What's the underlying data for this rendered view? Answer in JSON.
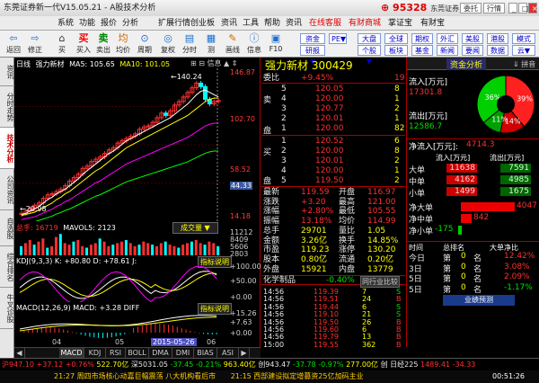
{
  "window": {
    "title": "东莞证券新一代V15.05.21 - A股技术分析",
    "version_tag": "50",
    "brand": "95328",
    "brand_sub": "东莞证券",
    "buttons": [
      "委托",
      "行情"
    ]
  },
  "menu": [
    "系统",
    "功能",
    "报价",
    "分析",
    "扩展行情",
    "创业板",
    "资讯",
    "工具",
    "帮助",
    "资讯",
    "在线客服",
    "有财商城",
    "掌证宝",
    "有财宝"
  ],
  "toolbar": {
    "tools": [
      "返回",
      "修正",
      "买",
      "卖",
      "均",
      "周期",
      "复权",
      "分时",
      "测",
      "画线",
      "信息",
      "F10"
    ],
    "right_buttons": [
      "资金▼",
      "研报▼",
      "PE▼",
      "大盘▼",
      "全球▼",
      "期权",
      "外汇",
      "美股",
      "港股",
      "个股▼",
      "板块",
      "基金▼",
      "新闻",
      "要闻",
      "数据▼",
      "个股▼",
      "模式",
      "云▼"
    ]
  },
  "left_tabs": [
    "资讯",
    "分时走势",
    "技术分析",
    "公司资讯",
    "自选股",
    "综合排名",
    "牛叉诊股"
  ],
  "chart": {
    "header": {
      "period": "日线",
      "name": "强力新材",
      "ma5": "MA5: 105.65",
      "ma10": "MA10: 101.05",
      "ma20": "MA20: 89.43",
      "ma60": "MA60: 66.02"
    },
    "price_max": "146.87",
    "price_2": "102.70",
    "price_3": "58.52",
    "price_4": "44.33",
    "price_min": "14.18",
    "high_label": "140.24",
    "low_label": "20.98",
    "vol_header": {
      "title": "总手: 16719",
      "mavol": "MAVOL5: 2123"
    },
    "vol_button": "成交量",
    "vol_labels": [
      "11212",
      "8409",
      "5606",
      "2803"
    ],
    "kdj_header": "KDJ(9,3,3) K: +80.80 D: +78.61 J:",
    "kdj_button": "指标说明",
    "kdj_labels": [
      "+100.00",
      "+50.00",
      "+0.00"
    ],
    "macd_header": "MACD(12,26,9) MACD: +3.28 DIFF",
    "macd_button": "指标说明",
    "macd_labels": [
      "+15.26",
      "+7.63",
      "+0.00"
    ],
    "dates": [
      "04",
      "05",
      "2015-05-26",
      "06"
    ],
    "price_levels": {
      "max": 146.87,
      "min": 14.18
    },
    "series": {
      "close": [
        21,
        23,
        25,
        28,
        30,
        34,
        37,
        38,
        40,
        42,
        45,
        49,
        52,
        55,
        60,
        62,
        66,
        68,
        70,
        73,
        76,
        78,
        82,
        84,
        86,
        88,
        90,
        94,
        96,
        97,
        100,
        104,
        108,
        106,
        110,
        115,
        118,
        122,
        126,
        130,
        134,
        131,
        120,
        116,
        118,
        119
      ],
      "ma5": [
        20,
        21,
        23,
        25,
        27,
        30,
        33,
        35,
        38,
        40,
        42,
        45,
        48,
        51,
        55,
        58,
        61,
        64,
        67,
        70,
        73,
        75,
        78,
        81,
        84,
        86,
        88,
        90,
        92,
        94,
        96,
        98,
        100,
        102,
        104,
        107,
        110,
        113,
        116,
        120,
        124,
        127,
        128,
        126,
        124,
        122
      ],
      "ma10": [
        19,
        20,
        21,
        22,
        24,
        26,
        28,
        30,
        33,
        35,
        38,
        40,
        43,
        46,
        49,
        52,
        55,
        58,
        60,
        63,
        66,
        69,
        72,
        75,
        78,
        80,
        82,
        84,
        86,
        88,
        90,
        92,
        94,
        96,
        98,
        100,
        102,
        104,
        106,
        109,
        112,
        115,
        118,
        120,
        121,
        121
      ]
    },
    "volume": [
      6,
      8,
      10,
      7,
      9,
      11,
      5,
      6,
      12,
      14,
      8,
      7,
      9,
      10,
      6,
      5,
      7,
      8,
      11,
      9,
      6,
      7,
      8,
      9,
      10,
      8,
      6,
      7,
      9,
      8,
      7,
      6,
      8,
      9,
      7,
      6,
      5,
      7,
      8,
      9,
      10,
      8,
      7,
      9,
      8,
      6
    ]
  },
  "bottom_tabs": [
    "MACD",
    "KDJ",
    "RSI",
    "BOLL",
    "DMA",
    "DMI",
    "BIAS",
    "ASI"
  ],
  "quote": {
    "title": "强力新材 300429",
    "webi": "+9.45%",
    "webi_label": "委比",
    "webi_right": "19",
    "sell": [
      {
        "lvl": "5",
        "p": "120.05",
        "v": "8"
      },
      {
        "lvl": "4",
        "p": "120.00",
        "v": "1"
      },
      {
        "lvl": "3",
        "p": "120.77",
        "v": "2"
      },
      {
        "lvl": "2",
        "p": "120.01",
        "v": "1"
      },
      {
        "lvl": "1",
        "p": "120.00",
        "v": "82"
      }
    ],
    "buy": [
      {
        "lvl": "1",
        "p": "120.52",
        "v": "6"
      },
      {
        "lvl": "2",
        "p": "120.00",
        "v": "8"
      },
      {
        "lvl": "3",
        "p": "120.01",
        "v": "2"
      },
      {
        "lvl": "4",
        "p": "120.00",
        "v": "1"
      },
      {
        "lvl": "5",
        "p": "119.50",
        "v": "2"
      }
    ],
    "sell_label": [
      "卖",
      "①",
      "盘"
    ],
    "buy_label": [
      "买",
      "①",
      "盘"
    ],
    "stats": [
      [
        "最新",
        "119.59",
        "开盘",
        "116.97"
      ],
      [
        "涨跌",
        "+3.20",
        "最高",
        "121.00"
      ],
      [
        "涨幅",
        "+2.80%",
        "最低",
        "105.55"
      ],
      [
        "振幅",
        "13.18%",
        "均价",
        "114.99"
      ],
      [
        "总手",
        "29701",
        "量比",
        "1.05"
      ],
      [
        "金额",
        "3.26亿",
        "换手",
        "14.85%"
      ],
      [
        "市盈",
        "119.23",
        "涨停",
        "130.20"
      ],
      [
        "股本",
        "0.80亿",
        "流通",
        "0.20亿"
      ],
      [
        "外盘",
        "15921",
        "内盘",
        "13779"
      ]
    ],
    "chem_label": "化学制品",
    "chem_val": "-0.40%",
    "chem_btn": "同行业比较",
    "ticks": [
      [
        "14:56",
        "119.39",
        "7",
        "S"
      ],
      [
        "14:56",
        "119.51",
        "24",
        "B"
      ],
      [
        "14:56",
        "119.44",
        "6",
        "S"
      ],
      [
        "14:56",
        "119.10",
        "21",
        "S"
      ],
      [
        "14:56",
        "119.50",
        "26",
        "B"
      ],
      [
        "14:56",
        "119.60",
        "6",
        "B"
      ],
      [
        "14:56",
        "119.79",
        "13",
        "B"
      ],
      [
        "15:00",
        "119.55",
        "362",
        "B"
      ]
    ]
  },
  "fund": {
    "tab": "资金分析",
    "tab2": "⇓ 拼音",
    "pie": [
      {
        "label": "39%",
        "value": 39,
        "color": "#ff2020"
      },
      {
        "label": "14%",
        "value": 14,
        "color": "#d00000"
      },
      {
        "label": "11%",
        "value": 11,
        "color": "#00a000"
      },
      {
        "label": "36%",
        "value": 36,
        "color": "#00d000"
      }
    ],
    "inflow_label": "流入[万元]",
    "inflow": "17301.8",
    "outflow_label": "流出[万元]",
    "outflow": "12586.7",
    "net_label": "净流入[万元]:",
    "net": "4714.3",
    "tbl_head": [
      "流入[万元]",
      "流出[万元]"
    ],
    "rows": [
      [
        "大单",
        "11638",
        "7591"
      ],
      [
        "中单",
        "4162",
        "4985"
      ],
      [
        "小单",
        "1499",
        "1675"
      ]
    ],
    "net_rows": [
      [
        "净大单",
        "4047",
        1
      ],
      [
        "净中单",
        "842",
        0.2
      ],
      [
        "净小单",
        "-175",
        -0.05
      ]
    ],
    "rank_head": [
      "时间",
      "总排名",
      "大单净比"
    ],
    "rank": [
      [
        "今日",
        "第",
        "0",
        "名",
        "12.42%"
      ],
      [
        "3日",
        "第",
        "0",
        "名",
        "3.08%"
      ],
      [
        "5日",
        "第",
        "0",
        "名",
        "2.09%"
      ],
      [
        "5日",
        "第",
        "0",
        "名",
        "-1.17%"
      ]
    ],
    "footer": "业绩预测"
  },
  "status1": {
    "sh": "沪947.10",
    "sh2": "+37.12",
    "sh3": "+0.76%",
    "sh4": "522.70亿",
    "sz": "深5031.05",
    "sz2": "-37.45",
    "sz3": "-0.21%",
    "sz4": "963.40亿",
    "cy": "创943.47",
    "cy2": "-37.78",
    "cy3": "-0.97%",
    "cy4": "277.00亿",
    "zh": "创",
    "zh2": "日经225",
    "tail": "1489.41 -34.33"
  },
  "status2": {
    "left": "21:27 周四市场核心动嘉巨幅震荡 八大机构看后市",
    "right": "21:15 西部建设拟定增募资25亿加码主业",
    "clock": "00:51:26"
  }
}
